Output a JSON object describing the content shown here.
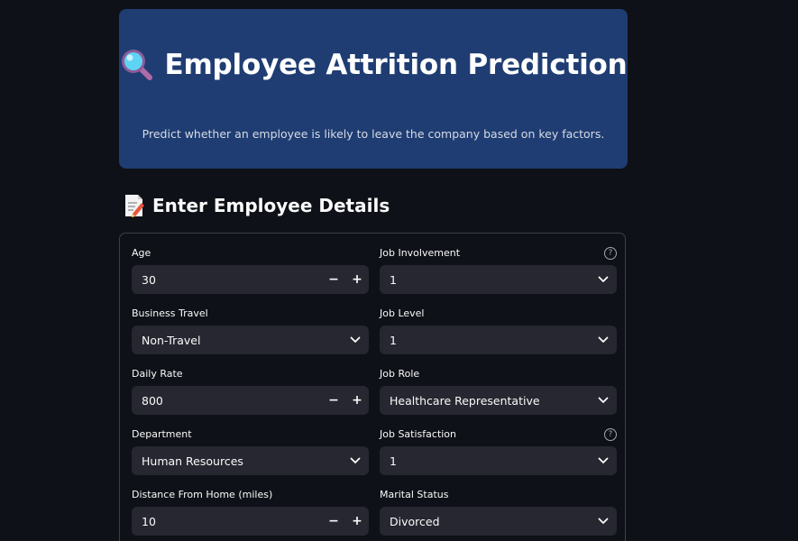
{
  "header": {
    "title": "Employee Attrition Prediction",
    "title_icon": "magnifying-glass-icon",
    "subtitle": "Predict whether an employee is likely to leave the company based on key factors.",
    "background": "#1f3d72"
  },
  "section": {
    "title": "Enter Employee Details",
    "icon": "memo-icon"
  },
  "form": {
    "left": [
      {
        "label": "Age",
        "value": "30",
        "type": "number",
        "minus": "−",
        "plus": "+"
      },
      {
        "label": "Business Travel",
        "value": "Non-Travel",
        "type": "select"
      },
      {
        "label": "Daily Rate",
        "value": "800",
        "type": "number",
        "minus": "−",
        "plus": "+"
      },
      {
        "label": "Department",
        "value": "Human Resources",
        "type": "select"
      },
      {
        "label": "Distance From Home (miles)",
        "value": "10",
        "type": "number",
        "minus": "−",
        "plus": "+"
      }
    ],
    "right": [
      {
        "label": "Job Involvement",
        "value": "1",
        "type": "select",
        "help": "?"
      },
      {
        "label": "Job Level",
        "value": "1",
        "type": "select"
      },
      {
        "label": "Job Role",
        "value": "Healthcare Representative",
        "type": "select"
      },
      {
        "label": "Job Satisfaction",
        "value": "1",
        "type": "select",
        "help": "?"
      },
      {
        "label": "Marital Status",
        "value": "Divorced",
        "type": "select"
      }
    ]
  },
  "colors": {
    "page_bg": "#0e1117",
    "input_bg": "#262730",
    "text": "#fafafa"
  }
}
